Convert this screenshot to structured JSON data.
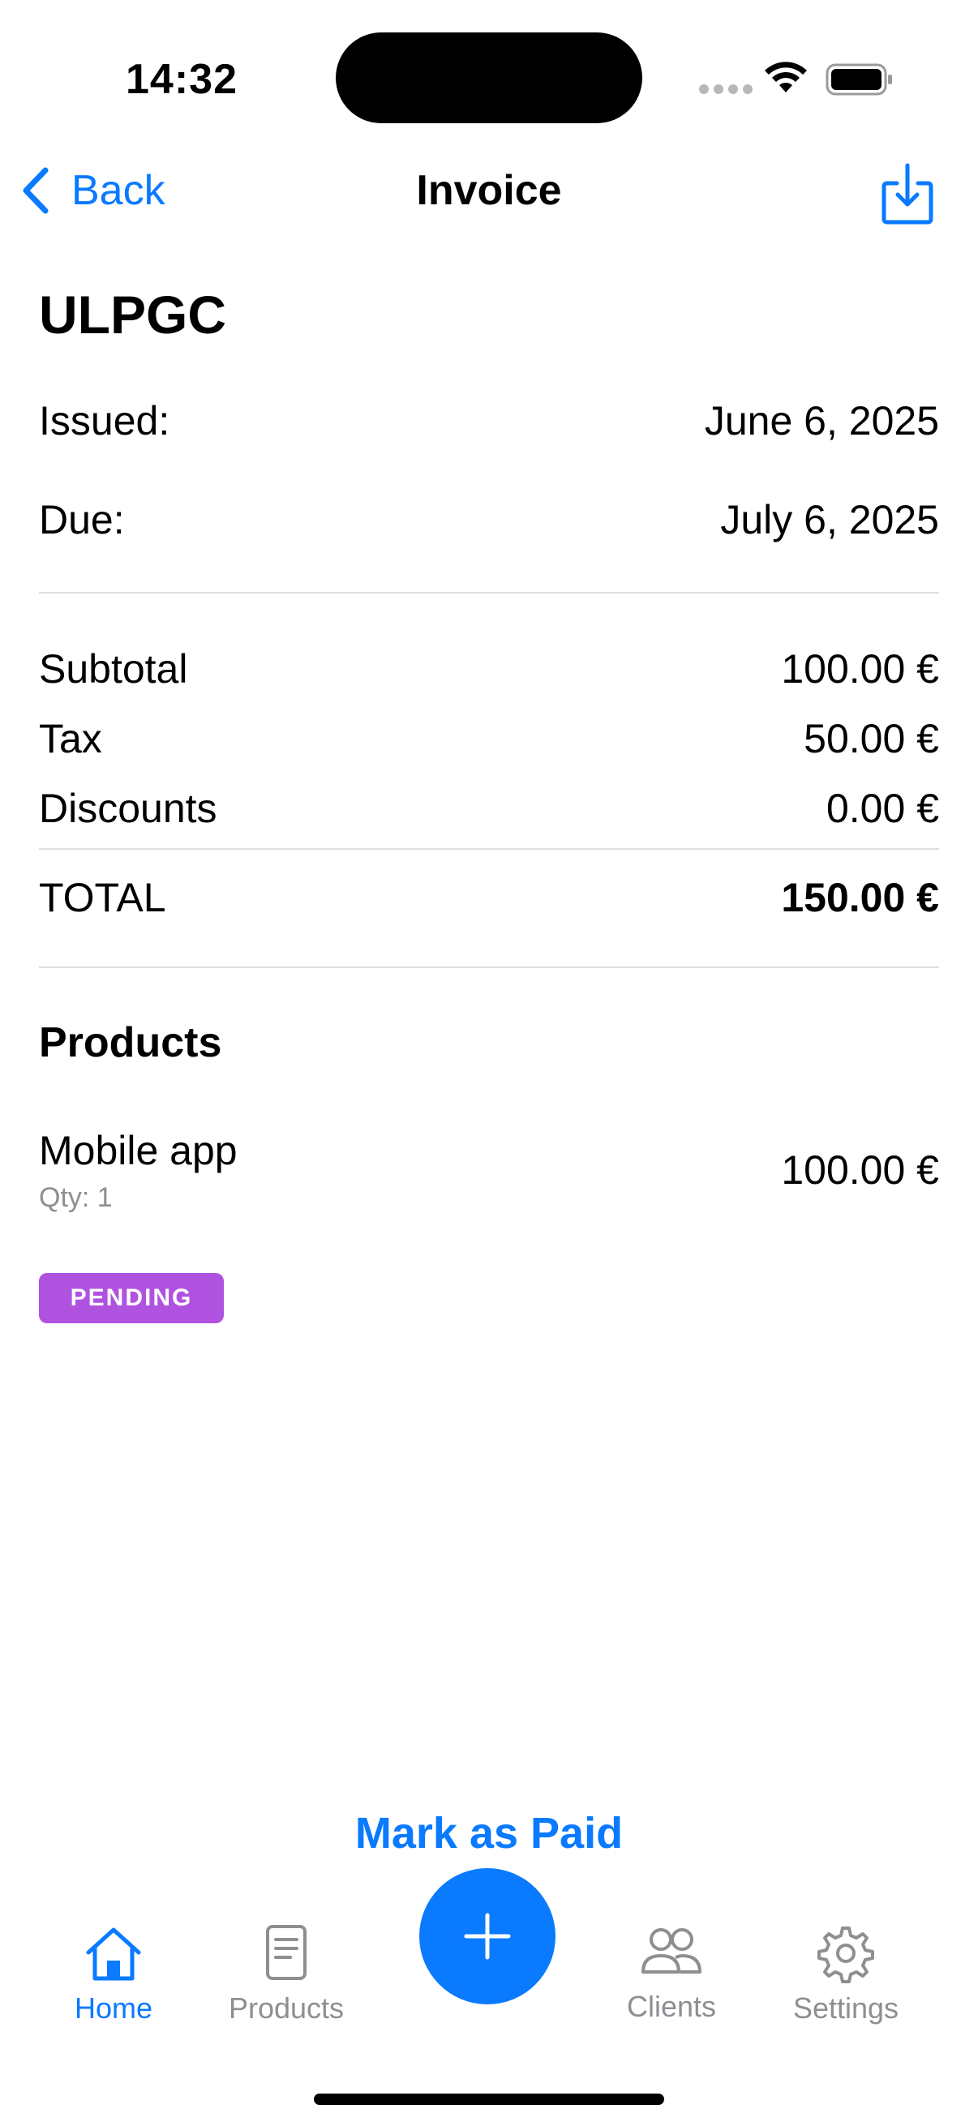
{
  "status_bar": {
    "time": "14:32"
  },
  "nav": {
    "back_label": "Back",
    "title": "Invoice",
    "share_icon": "download-tray-icon"
  },
  "invoice": {
    "client": "ULPGC",
    "issued_label": "Issued:",
    "issued_value": "June 6, 2025",
    "due_label": "Due:",
    "due_value": "July 6, 2025",
    "subtotal_label": "Subtotal",
    "subtotal_value": "100.00 €",
    "tax_label": "Tax",
    "tax_value": "50.00 €",
    "discounts_label": "Discounts",
    "discounts_value": "0.00 €",
    "total_label": "TOTAL",
    "total_value": "150.00 €"
  },
  "products": {
    "section_title": "Products",
    "items": [
      {
        "name": "Mobile app",
        "qty": "Qty: 1",
        "price": "100.00 €"
      }
    ]
  },
  "status": {
    "label": "PENDING",
    "color": "#b052e0"
  },
  "actions": {
    "mark_paid": "Mark as Paid"
  },
  "tab_bar": {
    "items": [
      {
        "label": "Home",
        "icon": "house-icon",
        "active": true
      },
      {
        "label": "Products",
        "icon": "document-icon",
        "active": false
      },
      {
        "label": "Clients",
        "icon": "people-icon",
        "active": false
      },
      {
        "label": "Settings",
        "icon": "gear-icon",
        "active": false
      }
    ],
    "fab_icon": "plus-icon"
  },
  "colors": {
    "accent": "#0a7aff",
    "secondary_text": "#8e8e93",
    "divider": "#dedede"
  }
}
